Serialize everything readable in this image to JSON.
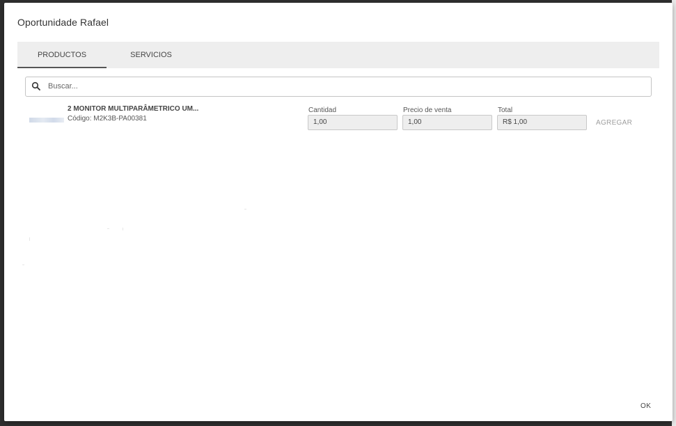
{
  "dialog": {
    "title": "Oportunidade Rafael"
  },
  "tabs": [
    {
      "label": "PRODUCTOS",
      "active": true
    },
    {
      "label": "SERVICIOS",
      "active": false
    }
  ],
  "search": {
    "placeholder": "Buscar...",
    "value": ""
  },
  "products": [
    {
      "name": "2 MONITOR MULTIPARÂMETRICO UM...",
      "code": "Código: M2K3B-PA00381",
      "fields": {
        "quantity_label": "Cantidad",
        "quantity_value": "1,00",
        "price_label": "Precio de venta",
        "price_value": "1,00",
        "total_label": "Total",
        "total_value": "R$ 1,00"
      },
      "add_label": "AGREGAR"
    }
  ],
  "footer": {
    "ok_label": "OK"
  },
  "colors": {
    "tab_bar_bg": "#eeeeee",
    "active_tab_indicator": "#555555",
    "disabled_text": "#9e9e9e"
  },
  "icons": {
    "search": "search-icon"
  }
}
